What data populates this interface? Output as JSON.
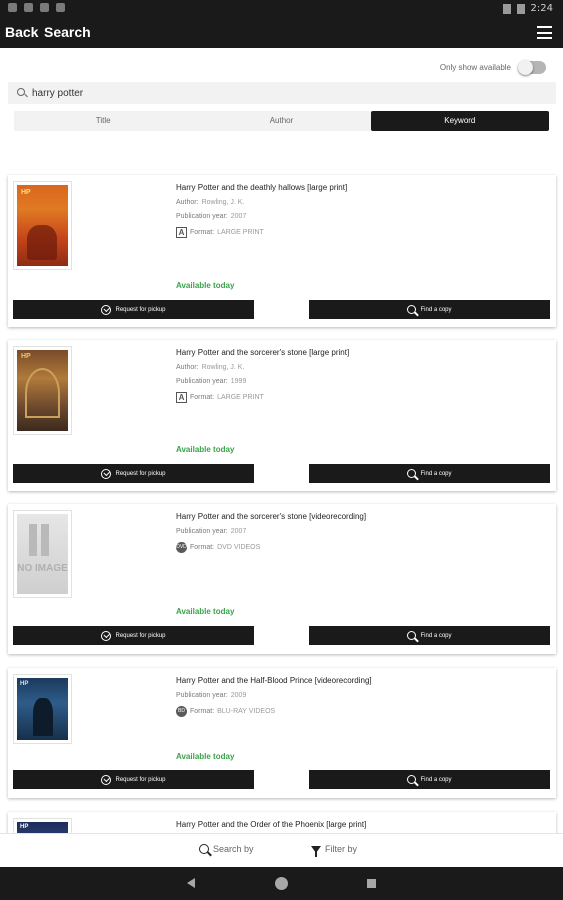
{
  "status_bar": {
    "time": "2:24"
  },
  "header": {
    "back_label": "Back",
    "title": "Search"
  },
  "toggle": {
    "label": "Only show available",
    "on": false
  },
  "search": {
    "value": "harry potter"
  },
  "tabs": [
    {
      "label": "Title",
      "active": false
    },
    {
      "label": "Author",
      "active": false
    },
    {
      "label": "Keyword",
      "active": true
    }
  ],
  "labels": {
    "author": "Author:",
    "publication_year": "Publication year:",
    "format": "Format:",
    "request_pickup": "Request for pickup",
    "find_copy": "Find a copy"
  },
  "results": [
    {
      "title": "Harry Potter and the deathly hallows [large print]",
      "author": "Rowling, J. K.",
      "year": "2007",
      "format": "LARGE PRINT",
      "format_icon": "large-print-icon",
      "availability": "Available today",
      "cover": "deathly-hallows-cover"
    },
    {
      "title": "Harry Potter and the sorcerer's stone [large print]",
      "author": "Rowling, J. K.",
      "year": "1999",
      "format": "LARGE PRINT",
      "format_icon": "large-print-icon",
      "availability": "Available today",
      "cover": "sorcerers-stone-cover"
    },
    {
      "title": "Harry Potter and the sorcerer's stone [videorecording]",
      "year": "2007",
      "format": "DVD VIDEOS",
      "format_icon": "dvd-icon",
      "availability": "Available today",
      "cover": "no-image-cover",
      "cover_text": "NO IMAGE"
    },
    {
      "title": "Harry Potter and the Half-Blood Prince [videorecording]",
      "year": "2009",
      "format": "BLU-RAY VIDEOS",
      "format_icon": "dvd-icon",
      "availability": "Available today",
      "cover": "half-blood-prince-cover"
    },
    {
      "title": "Harry Potter and the Order of the Phoenix [large print]",
      "cover": "order-of-phoenix-cover"
    }
  ],
  "bottom_bar": {
    "search_by": "Search by",
    "filter_by": "Filter by"
  },
  "colors": {
    "accent_dark": "#1a1a1a",
    "available_green": "#3aa34a"
  }
}
